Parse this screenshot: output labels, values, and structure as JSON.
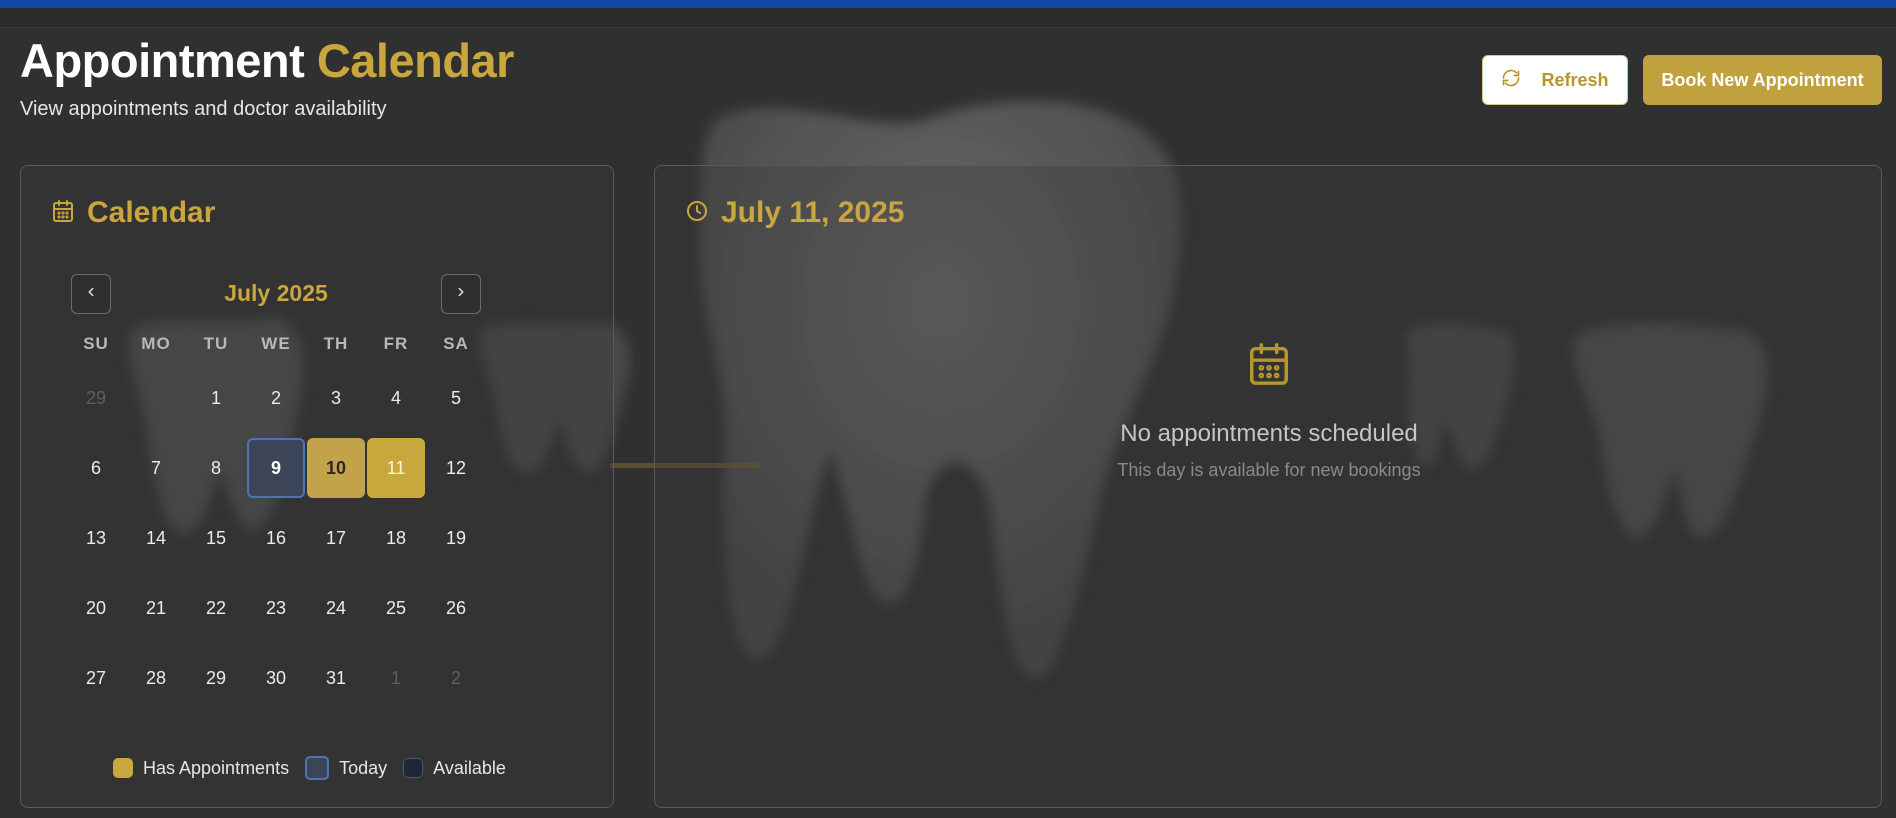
{
  "header": {
    "title_part1": "Appointment",
    "title_part2": "Calendar",
    "subtitle": "View appointments and doctor availability"
  },
  "actions": {
    "refresh_label": "Refresh",
    "book_label": "Book New Appointment"
  },
  "calendar_panel": {
    "title": "Calendar",
    "month_label": "July 2025",
    "weekdays": [
      "SU",
      "MO",
      "TU",
      "WE",
      "TH",
      "FR",
      "SA"
    ],
    "weeks": [
      [
        {
          "d": "29",
          "muted": true
        },
        {
          "d": "",
          "muted": true
        },
        {
          "d": "1"
        },
        {
          "d": "2"
        },
        {
          "d": "3"
        },
        {
          "d": "4"
        },
        {
          "d": "5"
        }
      ],
      [
        {
          "d": "6"
        },
        {
          "d": "7"
        },
        {
          "d": "8"
        },
        {
          "d": "9",
          "state": "today"
        },
        {
          "d": "10",
          "state": "appt"
        },
        {
          "d": "11",
          "state": "selected"
        },
        {
          "d": "12"
        }
      ],
      [
        {
          "d": "13"
        },
        {
          "d": "14"
        },
        {
          "d": "15"
        },
        {
          "d": "16"
        },
        {
          "d": "17"
        },
        {
          "d": "18"
        },
        {
          "d": "19"
        }
      ],
      [
        {
          "d": "20"
        },
        {
          "d": "21"
        },
        {
          "d": "22"
        },
        {
          "d": "23"
        },
        {
          "d": "24"
        },
        {
          "d": "25"
        },
        {
          "d": "26"
        }
      ],
      [
        {
          "d": "27"
        },
        {
          "d": "28"
        },
        {
          "d": "29"
        },
        {
          "d": "30"
        },
        {
          "d": "31"
        },
        {
          "d": "1",
          "muted": true
        },
        {
          "d": "2",
          "muted": true
        }
      ]
    ],
    "legend": {
      "has_appointments": "Has Appointments",
      "today": "Today",
      "available": "Available"
    }
  },
  "day_panel": {
    "date_title": "July 11, 2025",
    "empty_title": "No appointments scheduled",
    "empty_subtitle": "This day is available for new bookings"
  },
  "colors": {
    "accent_gold": "#c9a63e",
    "today_blue": "#4c72b8",
    "top_bar": "#0f4aa6"
  }
}
